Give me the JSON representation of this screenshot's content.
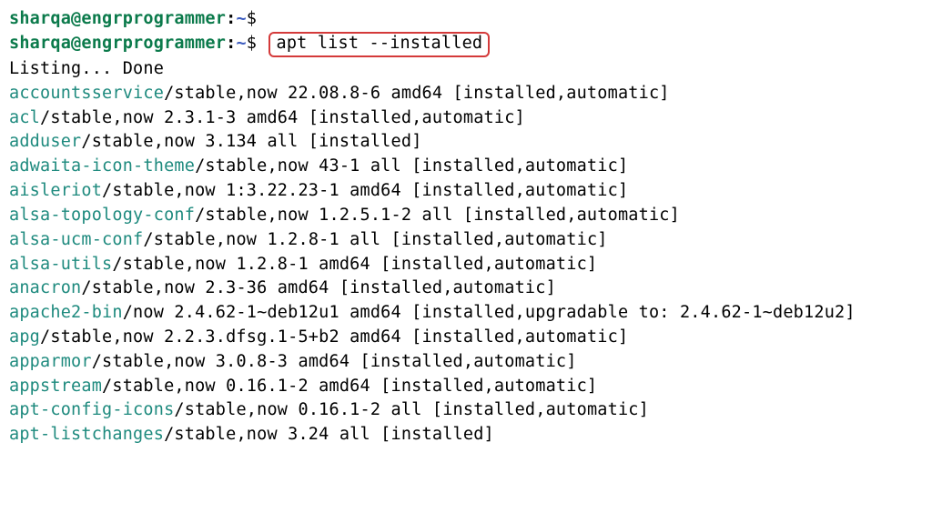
{
  "prompt": {
    "user": "sharqa@engrprogrammer",
    "colon": ":",
    "path": "~",
    "dollar": "$"
  },
  "command": "apt list --installed",
  "listing_header": "Listing... Done",
  "packages": [
    {
      "name": "accountsservice",
      "rest": "/stable,now 22.08.8-6 amd64 [installed,automatic]"
    },
    {
      "name": "acl",
      "rest": "/stable,now 2.3.1-3 amd64 [installed,automatic]"
    },
    {
      "name": "adduser",
      "rest": "/stable,now 3.134 all [installed]"
    },
    {
      "name": "adwaita-icon-theme",
      "rest": "/stable,now 43-1 all [installed,automatic]"
    },
    {
      "name": "aisleriot",
      "rest": "/stable,now 1:3.22.23-1 amd64 [installed,automatic]"
    },
    {
      "name": "alsa-topology-conf",
      "rest": "/stable,now 1.2.5.1-2 all [installed,automatic]"
    },
    {
      "name": "alsa-ucm-conf",
      "rest": "/stable,now 1.2.8-1 all [installed,automatic]"
    },
    {
      "name": "alsa-utils",
      "rest": "/stable,now 1.2.8-1 amd64 [installed,automatic]"
    },
    {
      "name": "anacron",
      "rest": "/stable,now 2.3-36 amd64 [installed,automatic]"
    },
    {
      "name": "apache2-bin",
      "rest": "/now 2.4.62-1~deb12u1 amd64 [installed,upgradable to: 2.4.62-1~deb12u2]"
    },
    {
      "name": "apg",
      "rest": "/stable,now 2.2.3.dfsg.1-5+b2 amd64 [installed,automatic]"
    },
    {
      "name": "apparmor",
      "rest": "/stable,now 3.0.8-3 amd64 [installed,automatic]"
    },
    {
      "name": "appstream",
      "rest": "/stable,now 0.16.1-2 amd64 [installed,automatic]"
    },
    {
      "name": "apt-config-icons",
      "rest": "/stable,now 0.16.1-2 all [installed,automatic]"
    },
    {
      "name": "apt-listchanges",
      "rest": "/stable,now 3.24 all [installed]"
    }
  ]
}
